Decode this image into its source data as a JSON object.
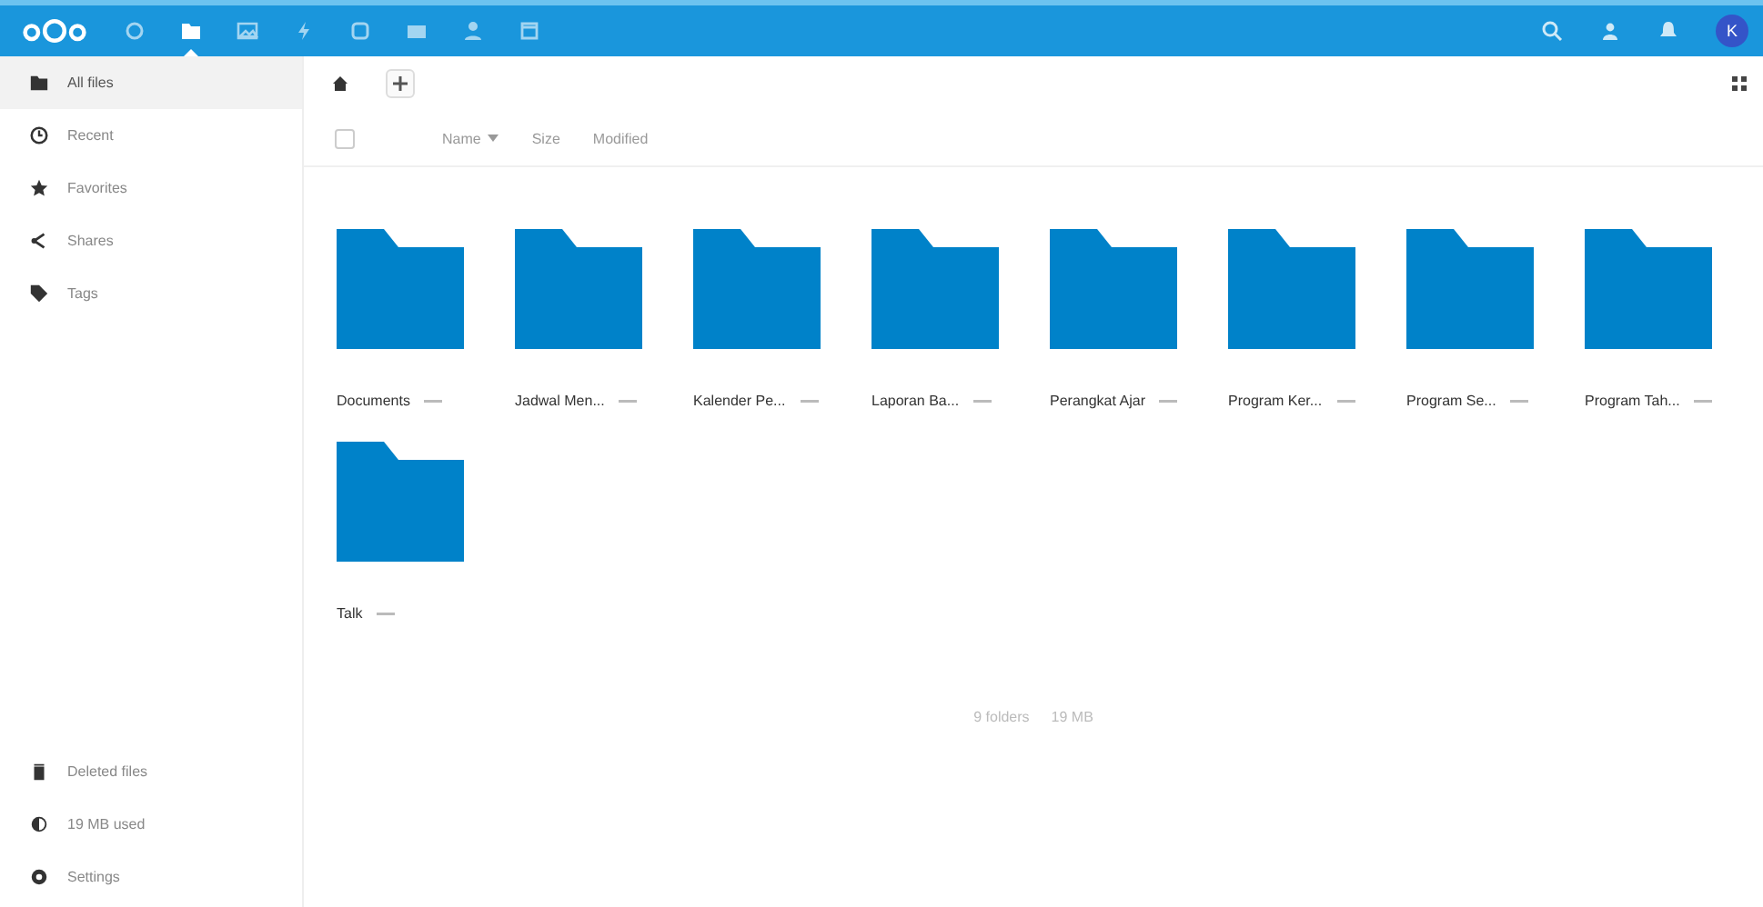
{
  "header": {
    "apps": [
      {
        "kind": "dashboard",
        "selected": false
      },
      {
        "kind": "files",
        "selected": true
      },
      {
        "kind": "photos",
        "selected": false
      },
      {
        "kind": "activity",
        "selected": false
      },
      {
        "kind": "talk",
        "selected": false
      },
      {
        "kind": "mail",
        "selected": false
      },
      {
        "kind": "contacts",
        "selected": false
      },
      {
        "kind": "calendar",
        "selected": false
      }
    ],
    "avatar": "K"
  },
  "sidebar": {
    "items": [
      {
        "label": "All files",
        "kind": "folder",
        "selected": true
      },
      {
        "label": "Recent",
        "kind": "clock",
        "selected": false
      },
      {
        "label": "Favorites",
        "kind": "star",
        "selected": false
      },
      {
        "label": "Shares",
        "kind": "share",
        "selected": false
      },
      {
        "label": "Tags",
        "kind": "tag",
        "selected": false
      }
    ],
    "footer": [
      {
        "label": "Deleted files",
        "kind": "trash"
      },
      {
        "label": "19 MB used",
        "kind": "quota"
      },
      {
        "label": "Settings",
        "kind": "gear"
      }
    ]
  },
  "select_all": {
    "checked": false
  },
  "columns": [
    {
      "label": "Name",
      "sort": true
    },
    {
      "label": "Size",
      "sort": false
    },
    {
      "label": "Modified",
      "sort": false
    }
  ],
  "folders": [
    {
      "name": "Documents"
    },
    {
      "name": "Jadwal Men..."
    },
    {
      "name": "Kalender Pe..."
    },
    {
      "name": "Laporan Ba..."
    },
    {
      "name": "Perangkat Ajar"
    },
    {
      "name": "Program Ker..."
    },
    {
      "name": "Program Se..."
    },
    {
      "name": "Program Tah..."
    },
    {
      "name": "Talk"
    }
  ],
  "summary": {
    "folders": "9 folders",
    "size": "19 MB"
  }
}
